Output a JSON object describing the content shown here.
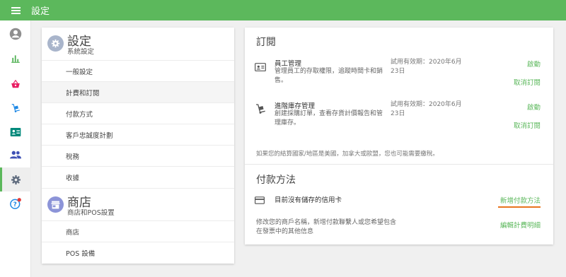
{
  "app": {
    "title": "設定"
  },
  "sidebar": {
    "icons": [
      "account-icon",
      "bar-chart-icon",
      "basket-icon",
      "hand-truck-icon",
      "contact-card-icon",
      "people-icon",
      "gear-icon",
      "help-icon"
    ]
  },
  "settings_menu": {
    "system": {
      "title": "設定",
      "subtitle": "系統設定"
    },
    "system_items": [
      "一般設定",
      "計費和訂閱",
      "付款方式",
      "客戶忠誠度計劃",
      "稅務",
      "收據"
    ],
    "store": {
      "title": "商店",
      "subtitle": "商店和POS設置"
    },
    "store_items": [
      "商店",
      "POS 設備"
    ],
    "active_item": "計費和訂閱"
  },
  "subscription": {
    "title": "訂閱",
    "rows": [
      {
        "icon": "id-card-icon",
        "name": "員工管理",
        "desc_1": "管理員工的存取權限，追蹤時間卡和銷",
        "desc_2": "售。",
        "trial_1": "試用有效期：2020年6月",
        "trial_2": "23日",
        "activate": "啟動",
        "cancel": "取消訂閱"
      },
      {
        "icon": "inventory-cart-icon",
        "name": "進階庫存管理",
        "desc_1": "創建採購訂單，查看存貨計價報告和管",
        "desc_2": "理庫存。",
        "trial_1": "試用有效期：2020年6月",
        "trial_2": "23日",
        "activate": "啟動",
        "cancel": "取消訂閱"
      }
    ],
    "note": "如果您的結算國家/地區是美國，加拿大或歐盟，您也可能需要繳稅。"
  },
  "payment": {
    "title": "付款方法",
    "card_status": "目前沒有儲存的信用卡",
    "add_link": "新增付款方法",
    "billing_1": "修改您的商戶名稱，新增付款聯繫人或您希望包含",
    "billing_2": "在發票中的其他信息",
    "edit_link": "編輯計費明細"
  },
  "colors": {
    "brand": "#5cb85c",
    "link": "#5cb85c",
    "underline": "#e8741e",
    "badge": "#e53935"
  }
}
